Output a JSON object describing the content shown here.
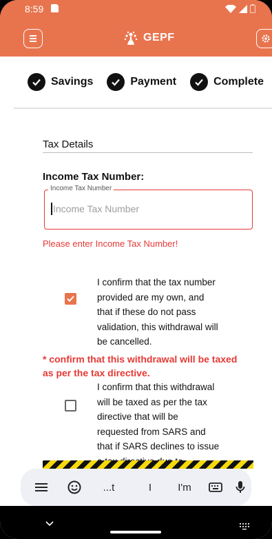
{
  "status_bar": {
    "time": "8:59"
  },
  "app_bar": {
    "brand": "GEPF",
    "menu_icon": "menu-icon",
    "settings_icon": "gear-icon"
  },
  "steps": [
    {
      "label": "Savings",
      "state": "complete"
    },
    {
      "label": "Payment",
      "state": "complete"
    },
    {
      "label": "Complete",
      "state": "complete"
    }
  ],
  "form": {
    "section_title": "Tax Details",
    "itn_heading": "Income Tax Number:",
    "itn_label": "Income Tax Number",
    "itn_placeholder": "Income Tax Number",
    "itn_value": "",
    "itn_error": "Please enter Income Tax Number!",
    "confirm_own": {
      "checked": true,
      "lines": [
        "I confirm that the tax number",
        "provided are my own, and",
        "that if these do not pass",
        "validation, this withdrawal will",
        "be cancelled."
      ]
    },
    "required_note": "* confirm that this withdrawal will be taxed as per the tax directive.",
    "confirm_directive": {
      "checked": false,
      "lines": [
        "I confirm that this withdrawal",
        "will be taxed as per the tax",
        "directive that will be",
        "requested from SARS and",
        "that if SARS declines to issue",
        "a tax directive due to"
      ]
    }
  },
  "keyboard": {
    "suggestions": [
      "...t",
      "I",
      "I'm"
    ],
    "icons": [
      "hamburger-menu-icon",
      "emoji-icon",
      "keyboard-icon",
      "microphone-icon"
    ]
  },
  "colors": {
    "accent": "#e8744e",
    "error": "#e53935",
    "hazard_yellow": "#f5d90a"
  }
}
